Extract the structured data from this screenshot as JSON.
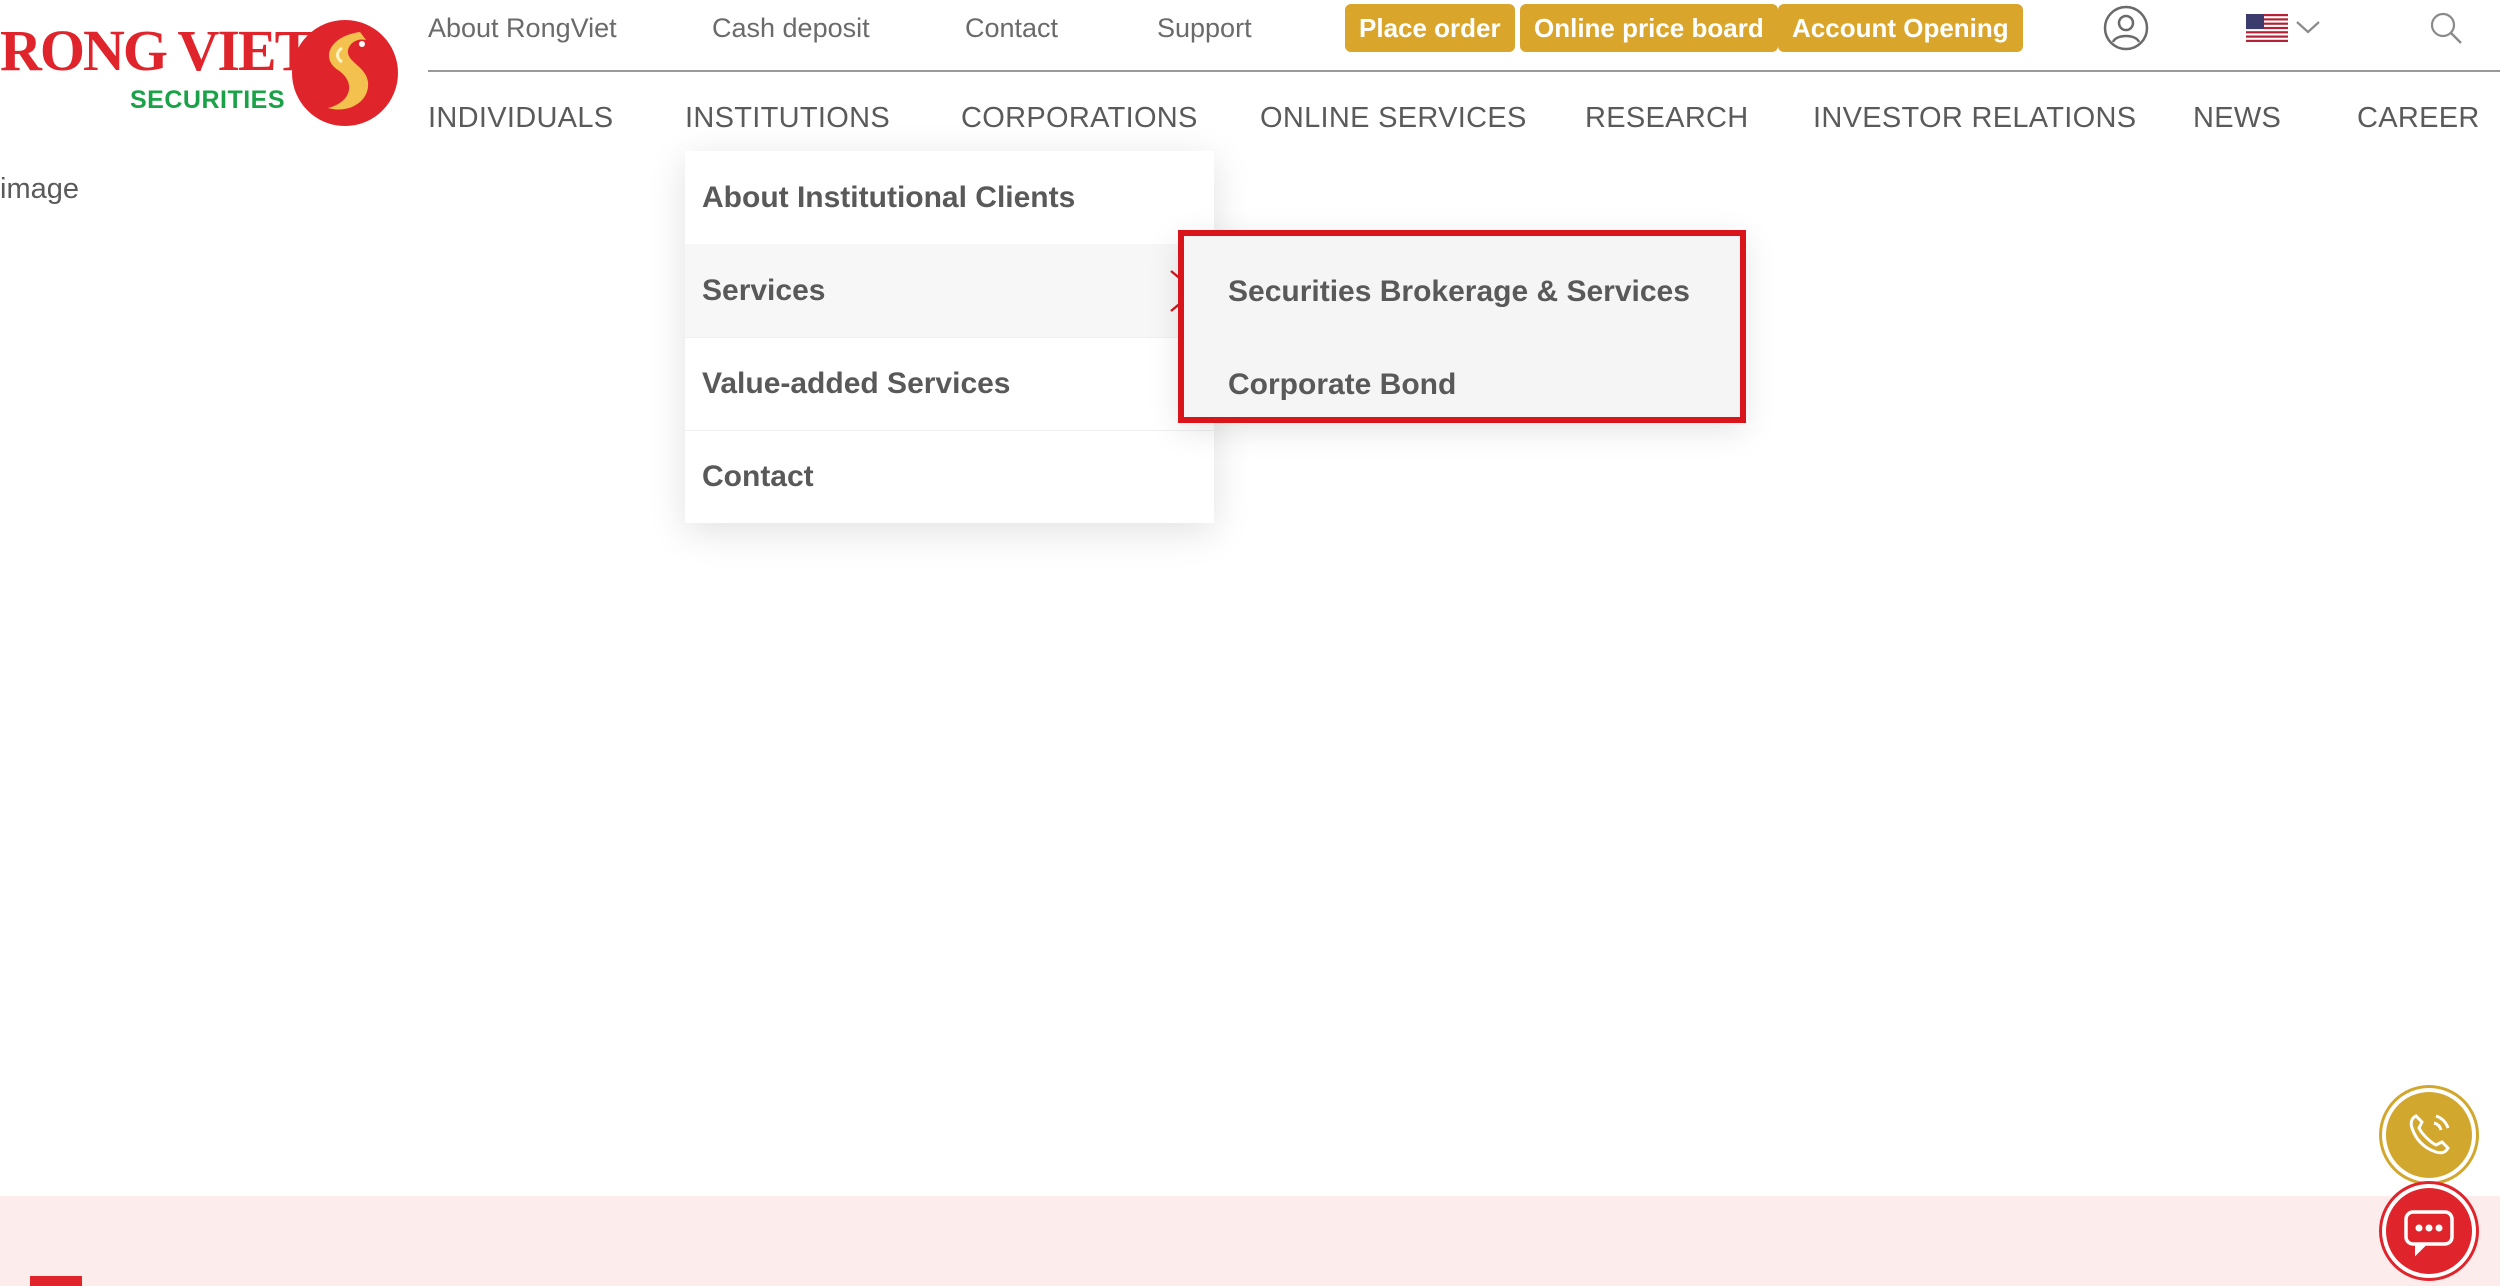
{
  "logo": {
    "wordmark": "RONG VIET",
    "sub": "SECURITIES",
    "emblem": "dragon-emblem-icon"
  },
  "topbar": {
    "links": [
      {
        "label": "About RongViet"
      },
      {
        "label": "Cash deposit"
      },
      {
        "label": "Contact"
      },
      {
        "label": "Support"
      }
    ],
    "buttons": [
      {
        "label": "Place order"
      },
      {
        "label": "Online price board"
      },
      {
        "label": "Account Opening"
      }
    ],
    "icons": [
      "user-icon",
      "us-flag-icon",
      "chevron-down-icon",
      "search-icon"
    ]
  },
  "nav": {
    "items": [
      {
        "label": "INDIVIDUALS"
      },
      {
        "label": "INSTITUTIONS"
      },
      {
        "label": "CORPORATIONS"
      },
      {
        "label": "ONLINE SERVICES"
      },
      {
        "label": "RESEARCH"
      },
      {
        "label": "INVESTOR RELATIONS"
      },
      {
        "label": "NEWS"
      },
      {
        "label": "CAREER"
      }
    ]
  },
  "broken_image": {
    "alt": "image"
  },
  "dropdown": {
    "items": [
      {
        "label": "About Institutional Clients"
      },
      {
        "label": "Services"
      },
      {
        "label": "Value-added Services"
      },
      {
        "label": "Contact"
      }
    ]
  },
  "submenu": {
    "items": [
      {
        "label": "Securities Brokerage & Services"
      },
      {
        "label": "Corporate Bond"
      }
    ]
  },
  "colors": {
    "brand_red": "#e0242b",
    "brand_green": "#1aa248",
    "accent_gold": "#d9a52b",
    "highlight_border": "#d9141b",
    "bottom_band": "#fdecec"
  }
}
